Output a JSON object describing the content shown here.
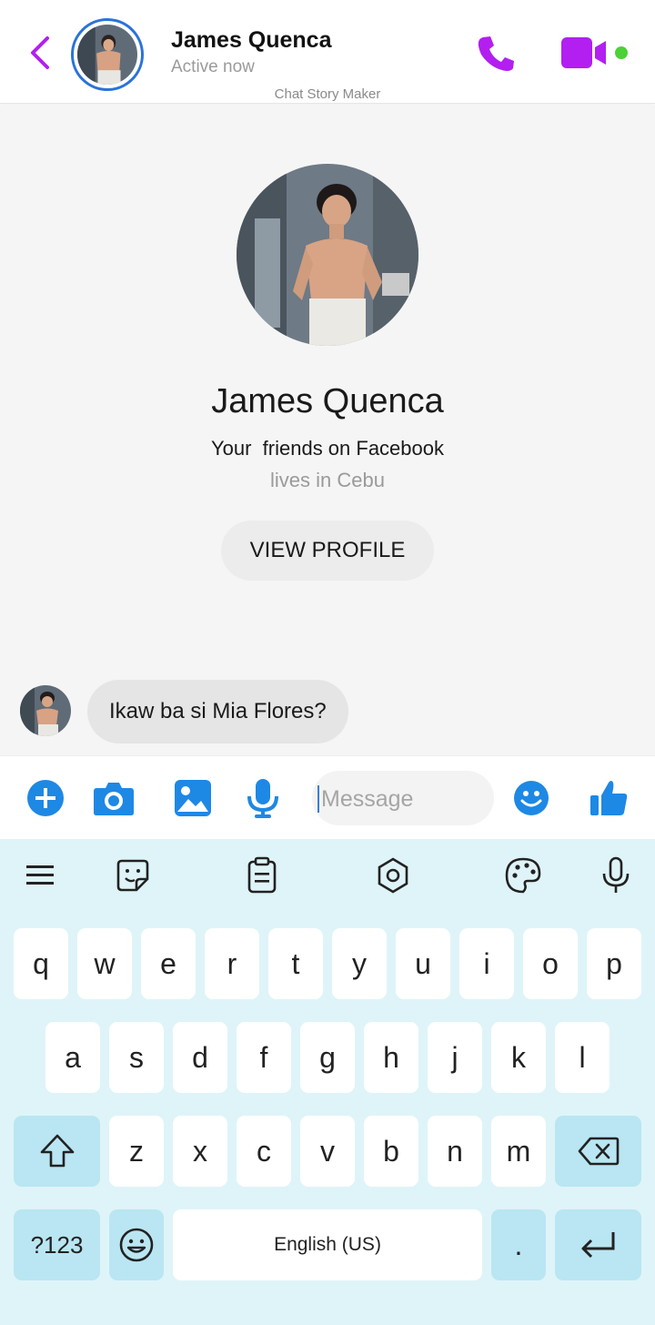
{
  "header": {
    "contact_name": "James Quenca",
    "status": "Active now",
    "watermark": "Chat Story Maker",
    "accent_color": "#b21ff0",
    "online_color": "#4cd137",
    "icons": [
      "back-arrow-icon",
      "phone-icon",
      "video-camera-icon"
    ]
  },
  "profile": {
    "name": "James Quenca",
    "friends_line": "Your  friends on Facebook",
    "location": "lives in Cebu",
    "view_profile_label": "VIEW PROFILE"
  },
  "messages": [
    {
      "sender": "James Quenca",
      "text": "Ikaw ba si Mia Flores?"
    }
  ],
  "composer": {
    "placeholder": "Message",
    "icon_color": "#1e88e5",
    "icons": [
      "add-icon",
      "camera-icon",
      "image-icon",
      "microphone-icon",
      "emoji-icon",
      "thumbs-up-icon"
    ]
  },
  "keyboard": {
    "toolbar_icons": [
      "menu-icon",
      "sticker-icon",
      "clipboard-icon",
      "settings-icon",
      "palette-icon",
      "voice-input-icon"
    ],
    "row1": [
      "q",
      "w",
      "e",
      "r",
      "t",
      "y",
      "u",
      "i",
      "o",
      "p"
    ],
    "row2": [
      "a",
      "s",
      "d",
      "f",
      "g",
      "h",
      "j",
      "k",
      "l"
    ],
    "row3": [
      "z",
      "x",
      "c",
      "v",
      "b",
      "n",
      "m"
    ],
    "symbols_label": "?123",
    "space_label": "English (US)",
    "period_label": "."
  }
}
